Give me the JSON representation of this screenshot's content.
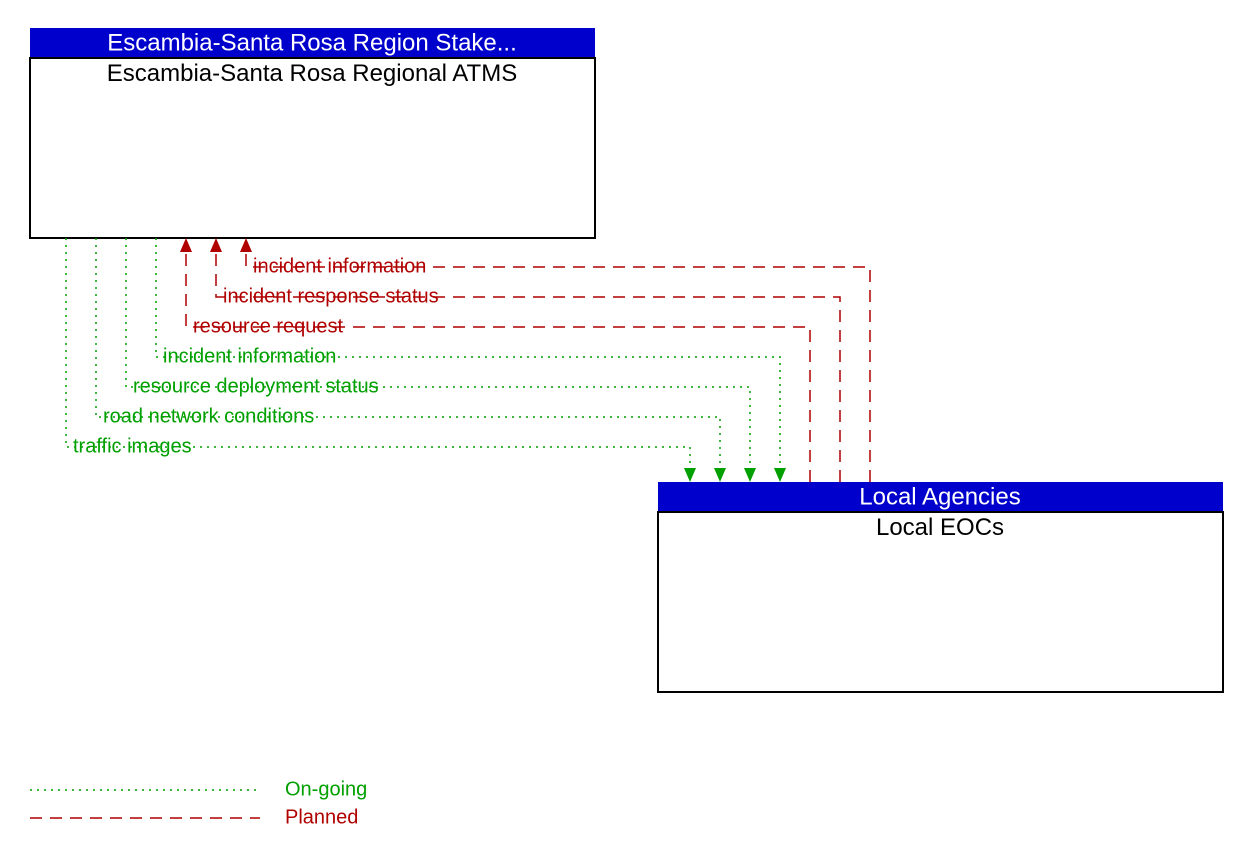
{
  "box_top": {
    "header": "Escambia-Santa Rosa Region Stake...",
    "body": "Escambia-Santa Rosa Regional ATMS"
  },
  "box_bottom": {
    "header": "Local Agencies",
    "body": "Local EOCs"
  },
  "flows": {
    "red1": "incident information",
    "red2": "incident response status",
    "red3": "resource request",
    "green1": "incident information",
    "green2": "resource deployment status",
    "green3": "road network conditions",
    "green4": "traffic images"
  },
  "legend": {
    "ongoing": "On-going",
    "planned": "Planned"
  }
}
